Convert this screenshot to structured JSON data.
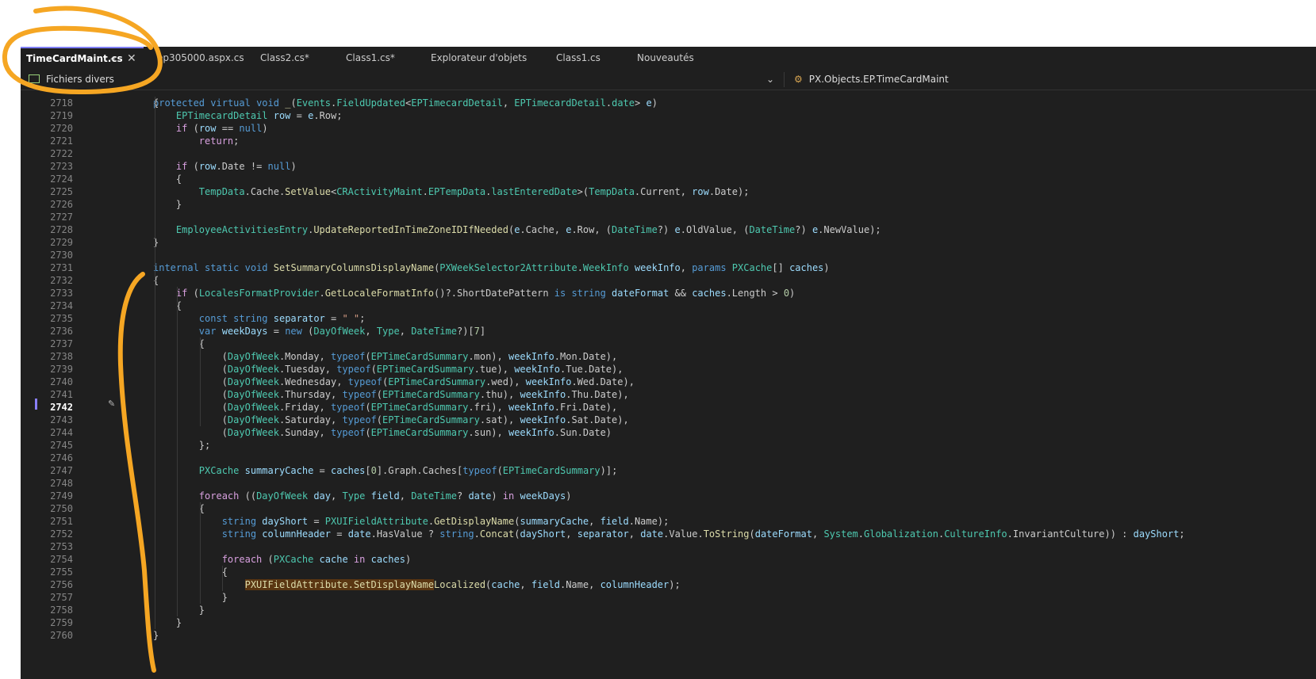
{
  "tabs": [
    {
      "label": "TimeCardMaint.cs",
      "active": true
    },
    {
      "label": "ep305000.aspx.cs",
      "active": false
    },
    {
      "label": "Class2.cs*",
      "active": false
    },
    {
      "label": "Class1.cs*",
      "active": false
    },
    {
      "label": "Explorateur d'objets",
      "active": false
    },
    {
      "label": "Class1.cs",
      "active": false
    },
    {
      "label": "Nouveautés",
      "active": false
    }
  ],
  "navbar": {
    "project": "Fichiers divers",
    "class_member": "PX.Objects.EP.TimeCardMaint"
  },
  "icons": {
    "pin": "pin-icon",
    "close": "close-icon",
    "file": "file-icon",
    "chevron": "chevron-down-icon",
    "class": "class-icon",
    "edit": "pencil-icon"
  },
  "editor": {
    "current_line": "2742",
    "partial_top_line": "protected virtual void _(Events.FieldUpdated<EPTimecardDetail, EPTimecardDetail.date> e)",
    "lines": [
      {
        "n": "2718",
        "code": "{"
      },
      {
        "n": "2719",
        "code": "    EPTimecardDetail row = e.Row;"
      },
      {
        "n": "2720",
        "code": "    if (row == null)"
      },
      {
        "n": "2721",
        "code": "        return;"
      },
      {
        "n": "2722",
        "code": ""
      },
      {
        "n": "2723",
        "code": "    if (row.Date != null)"
      },
      {
        "n": "2724",
        "code": "    {"
      },
      {
        "n": "2725",
        "code": "        TempData.Cache.SetValue<CRActivityMaint.EPTempData.lastEnteredDate>(TempData.Current, row.Date);"
      },
      {
        "n": "2726",
        "code": "    }"
      },
      {
        "n": "2727",
        "code": ""
      },
      {
        "n": "2728",
        "code": "    EmployeeActivitiesEntry.UpdateReportedInTimeZoneIDIfNeeded(e.Cache, e.Row, (DateTime?) e.OldValue, (DateTime?) e.NewValue);"
      },
      {
        "n": "2729",
        "code": "}"
      },
      {
        "n": "2730",
        "code": ""
      },
      {
        "n": "2731",
        "code": "internal static void SetSummaryColumnsDisplayName(PXWeekSelector2Attribute.WeekInfo weekInfo, params PXCache[] caches)"
      },
      {
        "n": "2732",
        "code": "{"
      },
      {
        "n": "2733",
        "code": "    if (LocalesFormatProvider.GetLocaleFormatInfo()?.ShortDatePattern is string dateFormat && caches.Length > 0)"
      },
      {
        "n": "2734",
        "code": "    {"
      },
      {
        "n": "2735",
        "code": "        const string separator = \" \";"
      },
      {
        "n": "2736",
        "code": "        var weekDays = new (DayOfWeek, Type, DateTime?)[7]"
      },
      {
        "n": "2737",
        "code": "        {"
      },
      {
        "n": "2738",
        "code": "            (DayOfWeek.Monday, typeof(EPTimeCardSummary.mon), weekInfo.Mon.Date),"
      },
      {
        "n": "2739",
        "code": "            (DayOfWeek.Tuesday, typeof(EPTimeCardSummary.tue), weekInfo.Tue.Date),"
      },
      {
        "n": "2740",
        "code": "            (DayOfWeek.Wednesday, typeof(EPTimeCardSummary.wed), weekInfo.Wed.Date),"
      },
      {
        "n": "2741",
        "code": "            (DayOfWeek.Thursday, typeof(EPTimeCardSummary.thu), weekInfo.Thu.Date),"
      },
      {
        "n": "2742",
        "code": "            (DayOfWeek.Friday, typeof(EPTimeCardSummary.fri), weekInfo.Fri.Date),"
      },
      {
        "n": "2743",
        "code": "            (DayOfWeek.Saturday, typeof(EPTimeCardSummary.sat), weekInfo.Sat.Date),"
      },
      {
        "n": "2744",
        "code": "            (DayOfWeek.Sunday, typeof(EPTimeCardSummary.sun), weekInfo.Sun.Date)"
      },
      {
        "n": "2745",
        "code": "        };"
      },
      {
        "n": "2746",
        "code": ""
      },
      {
        "n": "2747",
        "code": "        PXCache summaryCache = caches[0].Graph.Caches[typeof(EPTimeCardSummary)];"
      },
      {
        "n": "2748",
        "code": ""
      },
      {
        "n": "2749",
        "code": "        foreach ((DayOfWeek day, Type field, DateTime? date) in weekDays)"
      },
      {
        "n": "2750",
        "code": "        {"
      },
      {
        "n": "2751",
        "code": "            string dayShort = PXUIFieldAttribute.GetDisplayName(summaryCache, field.Name);"
      },
      {
        "n": "2752",
        "code": "            string columnHeader = date.HasValue ? string.Concat(dayShort, separator, date.Value.ToString(dateFormat, System.Globalization.CultureInfo.InvariantCulture)) : dayShort;"
      },
      {
        "n": "2753",
        "code": ""
      },
      {
        "n": "2754",
        "code": "            foreach (PXCache cache in caches)"
      },
      {
        "n": "2755",
        "code": "            {"
      },
      {
        "n": "2756",
        "code": "                PXUIFieldAttribute.SetDisplayNameLocalized(cache, field.Name, columnHeader);"
      },
      {
        "n": "2757",
        "code": "            }"
      },
      {
        "n": "2758",
        "code": "        }"
      },
      {
        "n": "2759",
        "code": "    }"
      },
      {
        "n": "2760",
        "code": "}"
      }
    ]
  },
  "colors": {
    "annotation": "#f5a623",
    "editor_bg": "#1f1f1f",
    "keyword": "#569cd6",
    "type": "#4ec9b0",
    "method": "#dcdcaa",
    "highlight": "#5a3612"
  }
}
